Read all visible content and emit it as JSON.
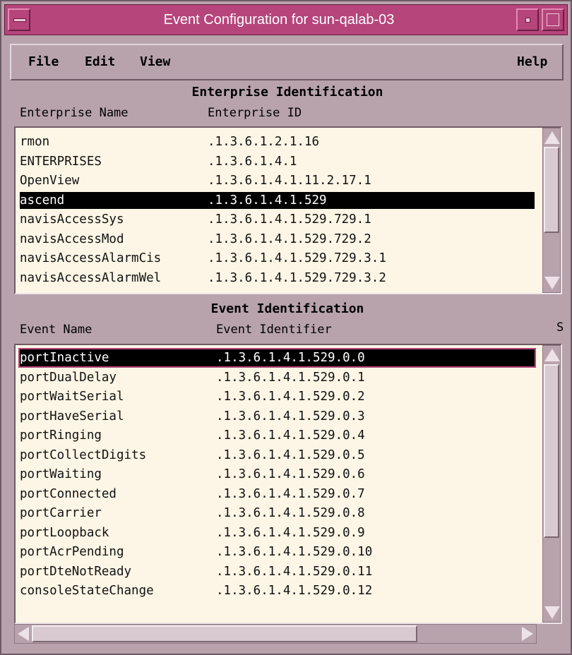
{
  "window": {
    "title": "Event Configuration for sun-qalab-03"
  },
  "menu": {
    "file": "File",
    "edit": "Edit",
    "view": "View",
    "help": "Help"
  },
  "enterprise": {
    "heading": "Enterprise Identification",
    "col_name": "Enterprise Name",
    "col_id": "Enterprise ID",
    "rows": [
      {
        "name": "rmon",
        "id": ".1.3.6.1.2.1.16"
      },
      {
        "name": "ENTERPRISES",
        "id": ".1.3.6.1.4.1"
      },
      {
        "name": "OpenView",
        "id": ".1.3.6.1.4.1.11.2.17.1"
      },
      {
        "name": "ascend",
        "id": ".1.3.6.1.4.1.529"
      },
      {
        "name": "navisAccessSys",
        "id": ".1.3.6.1.4.1.529.729.1"
      },
      {
        "name": "navisAccessMod",
        "id": ".1.3.6.1.4.1.529.729.2"
      },
      {
        "name": "navisAccessAlarmCis",
        "id": ".1.3.6.1.4.1.529.729.3.1"
      },
      {
        "name": "navisAccessAlarmWel",
        "id": ".1.3.6.1.4.1.529.729.3.2"
      }
    ],
    "selected_index": 3
  },
  "event": {
    "heading": "Event Identification",
    "col_name": "Event Name",
    "col_id": "Event Identifier",
    "col_cut": "S",
    "rows": [
      {
        "name": "portInactive",
        "id": ".1.3.6.1.4.1.529.0.0"
      },
      {
        "name": "portDualDelay",
        "id": ".1.3.6.1.4.1.529.0.1"
      },
      {
        "name": "portWaitSerial",
        "id": ".1.3.6.1.4.1.529.0.2"
      },
      {
        "name": "portHaveSerial",
        "id": ".1.3.6.1.4.1.529.0.3"
      },
      {
        "name": "portRinging",
        "id": ".1.3.6.1.4.1.529.0.4"
      },
      {
        "name": "portCollectDigits",
        "id": ".1.3.6.1.4.1.529.0.5"
      },
      {
        "name": "portWaiting",
        "id": ".1.3.6.1.4.1.529.0.6"
      },
      {
        "name": "portConnected",
        "id": ".1.3.6.1.4.1.529.0.7"
      },
      {
        "name": "portCarrier",
        "id": ".1.3.6.1.4.1.529.0.8"
      },
      {
        "name": "portLoopback",
        "id": ".1.3.6.1.4.1.529.0.9"
      },
      {
        "name": "portAcrPending",
        "id": ".1.3.6.1.4.1.529.0.10"
      },
      {
        "name": "portDteNotReady",
        "id": ".1.3.6.1.4.1.529.0.11"
      },
      {
        "name": "consoleStateChange",
        "id": ".1.3.6.1.4.1.529.0.12"
      }
    ],
    "selected_index": 0
  },
  "colors": {
    "titlebar": "#b5457a",
    "chrome": "#b8a3ad",
    "list_bg": "#fdf6e6",
    "selection": "#000000"
  },
  "icons": [
    "window-menu-icon",
    "minimize-icon",
    "maximize-icon",
    "scroll-up-icon",
    "scroll-down-icon",
    "scroll-left-icon",
    "scroll-right-icon"
  ]
}
